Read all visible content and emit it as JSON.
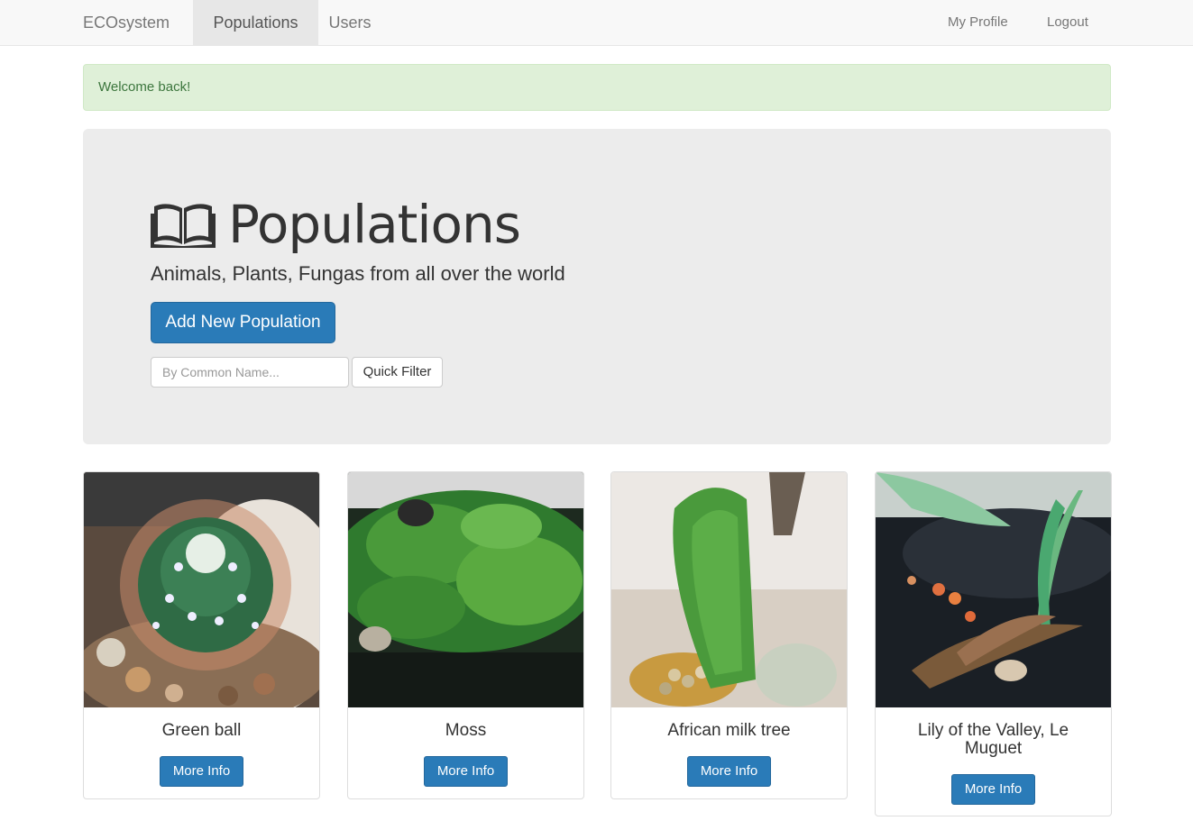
{
  "navbar": {
    "brand": "ECOsystem",
    "links": [
      "Populations",
      "Users"
    ],
    "right_links": [
      "My Profile",
      "Logout"
    ]
  },
  "alert": {
    "message": "Welcome back!"
  },
  "jumbotron": {
    "icon": "book-open-icon",
    "title": "Populations",
    "subtitle": "Animals, Plants, Fungas from all over the world",
    "add_button": "Add New Population",
    "filter_placeholder": "By Common Name...",
    "filter_button": "Quick Filter"
  },
  "cards": [
    {
      "title": "Green ball",
      "button": "More Info",
      "image": "cactus-photo"
    },
    {
      "title": "Moss",
      "button": "More Info",
      "image": "moss-photo"
    },
    {
      "title": "African milk tree",
      "button": "More Info",
      "image": "milk-tree-photo"
    },
    {
      "title": "Lily of the Valley, Le Muguet",
      "button": "More Info",
      "image": "lily-photo"
    }
  ],
  "colors": {
    "primary": "#2a7bb8",
    "alert_bg": "#dff0d8",
    "alert_text": "#3c763d",
    "jumbotron_bg": "#ececec"
  }
}
